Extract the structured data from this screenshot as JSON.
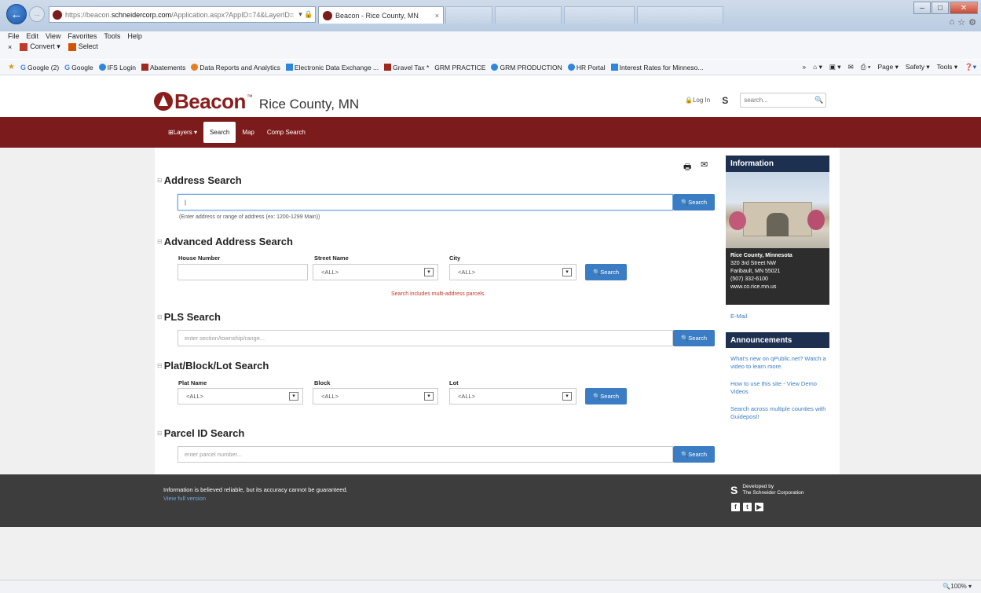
{
  "browser": {
    "url_grey": "https://beacon.",
    "url_domain": "schneidercorp.com",
    "url_rest": "/Application.aspx?AppID=74&LayerID=",
    "url_tail": "▾ 🔒 C",
    "tab_title": "Beacon - Rice County, MN",
    "tab_close": "×",
    "menus": [
      "File",
      "Edit",
      "View",
      "Favorites",
      "Tools",
      "Help"
    ],
    "cmd_close": "×",
    "cmd_convert": "Convert ▾",
    "cmd_select": "Select",
    "favorites": [
      "Google (2)",
      "Google",
      "IFS Login",
      "Abatements",
      "Data Reports and Analytics",
      "Electronic Data Exchange ...",
      "Gravel Tax *",
      "GRM PRACTICE",
      "GRM PRODUCTION",
      "HR Portal",
      "Interest Rates for Minneso..."
    ],
    "fav_chevron": "»",
    "tools": [
      "Page ▾",
      "Safety ▾",
      "Tools ▾"
    ],
    "zoom": "🔍100%  ▾"
  },
  "header": {
    "logo_word": "Beacon",
    "logo_tm": "™",
    "county": "Rice County, MN",
    "login": "🔒Log In",
    "search_placeholder": "search..."
  },
  "nav": {
    "items": [
      "⊞Layers ▾",
      "Search",
      "Map",
      "Comp Search"
    ]
  },
  "address_search": {
    "title": "Address Search",
    "input_value": "|",
    "hint": "(Enter address or range of address (ex: 1200-1299 Main))",
    "button": "🔍Search"
  },
  "advanced_search": {
    "title": "Advanced Address Search",
    "house_label": "House Number",
    "street_label": "Street Name",
    "city_label": "City",
    "street_value": "<ALL>",
    "city_value": "<ALL>",
    "button": "🔍Search",
    "warning": "Search includes multi-address parcels."
  },
  "pls_search": {
    "title": "PLS Search",
    "placeholder": "enter section/township/range...",
    "button": "🔍Search"
  },
  "plat_search": {
    "title": "Plat/Block/Lot Search",
    "plat_label": "Plat Name",
    "block_label": "Block",
    "lot_label": "Lot",
    "plat_value": "<ALL>",
    "block_value": "<ALL>",
    "lot_value": "<ALL>",
    "button": "🔍Search"
  },
  "parcel_search": {
    "title": "Parcel ID Search",
    "placeholder": "enter parcel number...",
    "button": "🔍Search"
  },
  "sidebar": {
    "info_title": "Information",
    "org_name": "Rice County, Minnesota",
    "street": "320 3rd Street NW",
    "city": "Faribault, MN 55021",
    "phone": "(507) 332-6100",
    "web": "www.co.rice.mn.us",
    "email": "E-Mail",
    "ann_title": "Announcements",
    "announcements": [
      "What's new on qPublic.net? Watch a video to learn more.",
      "How to use this site - View Demo Videos",
      "Search across multiple counties with Guidepost!"
    ]
  },
  "footer": {
    "disclaimer": "Information is believed reliable, but its accuracy cannot be guaranteed.",
    "full_version": "View full version",
    "dev_line1": "Developed by",
    "dev_line2": "The Schneider Corporation",
    "social": [
      "f",
      "t",
      "▶"
    ]
  },
  "colors": {
    "brand_red": "#7c1b1b",
    "button_blue": "#3b7dc4",
    "sidebar_navy": "#1e3050",
    "footer_grey": "#3d3d3d"
  }
}
